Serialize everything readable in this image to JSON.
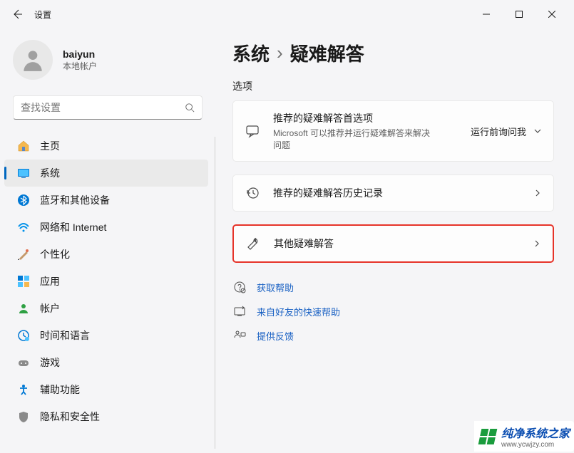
{
  "window": {
    "title": "设置"
  },
  "user": {
    "name": "baiyun",
    "type": "本地帐户"
  },
  "search": {
    "placeholder": "查找设置"
  },
  "sidebar": {
    "items": [
      {
        "label": "主页",
        "icon": "home"
      },
      {
        "label": "系统",
        "icon": "system",
        "active": true
      },
      {
        "label": "蓝牙和其他设备",
        "icon": "bluetooth"
      },
      {
        "label": "网络和 Internet",
        "icon": "network"
      },
      {
        "label": "个性化",
        "icon": "personalize"
      },
      {
        "label": "应用",
        "icon": "apps"
      },
      {
        "label": "帐户",
        "icon": "account"
      },
      {
        "label": "时间和语言",
        "icon": "time"
      },
      {
        "label": "游戏",
        "icon": "gaming"
      },
      {
        "label": "辅助功能",
        "icon": "accessibility"
      },
      {
        "label": "隐私和安全性",
        "icon": "privacy"
      }
    ]
  },
  "breadcrumb": {
    "parent": "系统",
    "sep": "›",
    "current": "疑难解答"
  },
  "section": {
    "title": "选项"
  },
  "cards": [
    {
      "title": "推荐的疑难解答首选项",
      "desc": "Microsoft 可以推荐并运行疑难解答来解决问题",
      "select": "运行前询问我",
      "icon": "chat"
    },
    {
      "title": "推荐的疑难解答历史记录",
      "icon": "history"
    },
    {
      "title": "其他疑难解答",
      "icon": "wrench",
      "highlight": true
    }
  ],
  "links": [
    {
      "label": "获取帮助",
      "icon": "help"
    },
    {
      "label": "来自好友的快速帮助",
      "icon": "quick"
    },
    {
      "label": "提供反馈",
      "icon": "feedback"
    }
  ],
  "watermark": {
    "brand": "纯净系统之家",
    "url": "www.ycwjzy.com"
  }
}
